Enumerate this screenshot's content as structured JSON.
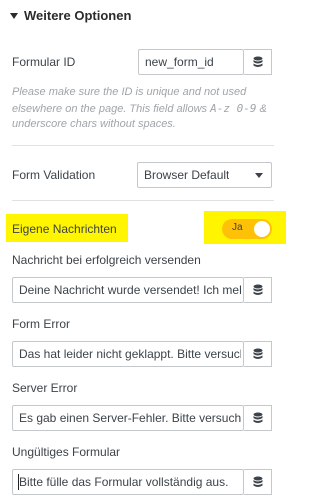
{
  "section": {
    "title": "Weitere Optionen",
    "icon": "caret-down-icon"
  },
  "form_id": {
    "label": "Formular ID",
    "value": "new_form_id",
    "hint_part1": "Please make sure the ID is unique and not used elsewhere on the page. This field allows ",
    "hint_code": "A-z 0-9",
    "hint_part2": " & underscore chars without spaces."
  },
  "validation": {
    "label": "Form Validation",
    "selected": "Browser Default"
  },
  "custom_messages": {
    "label": "Eigene Nachrichten",
    "toggle_label": "Ja",
    "enabled": true
  },
  "messages": [
    {
      "label": "Nachricht bei erfolgreich versenden",
      "value": "Deine Nachricht wurde versendet! Ich melde mich"
    },
    {
      "label": "Form Error",
      "value": "Das hat leider nicht geklappt. Bitte versuche es"
    },
    {
      "label": "Server Error",
      "value": "Es gab einen Server-Fehler. Bitte versuche es"
    },
    {
      "label": "Ungültiges Formular",
      "value": "Bitte fülle das Formular vollständig aus."
    }
  ],
  "colors": {
    "highlight": "#fff500",
    "toggle": "#ffc107"
  }
}
